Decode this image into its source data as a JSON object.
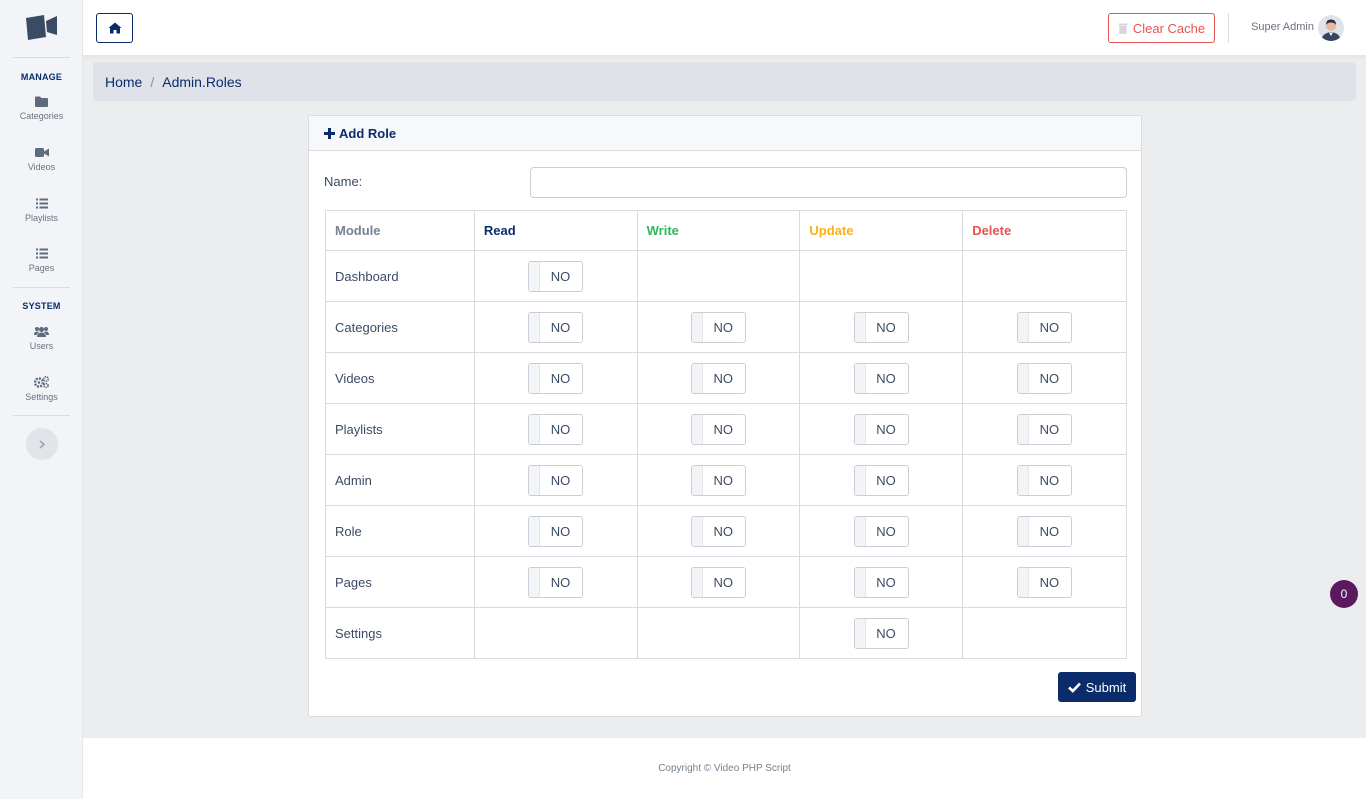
{
  "sidebar": {
    "sections": [
      {
        "title": "MANAGE",
        "items": [
          {
            "label": "Categories",
            "icon": "folder-icon"
          },
          {
            "label": "Videos",
            "icon": "video-icon"
          },
          {
            "label": "Playlists",
            "icon": "list-icon"
          },
          {
            "label": "Pages",
            "icon": "list-icon"
          }
        ]
      },
      {
        "title": "SYSTEM",
        "items": [
          {
            "label": "Users",
            "icon": "users-icon"
          },
          {
            "label": "Settings",
            "icon": "cogs-icon"
          }
        ]
      }
    ],
    "toggle_icon": "chevron-right-icon"
  },
  "header": {
    "clear_cache_label": "Clear Cache",
    "user_name": "Super Admin"
  },
  "breadcrumb": {
    "items": [
      "Home",
      "Admin.Roles"
    ]
  },
  "form": {
    "title": "Add Role",
    "name_label": "Name:",
    "name_value": "",
    "submit_label": "Submit",
    "columns": {
      "module": "Module",
      "read": "Read",
      "write": "Write",
      "update": "Update",
      "delete": "Delete"
    },
    "rows": [
      {
        "module": "Dashboard",
        "read": "NO",
        "write": "",
        "update": "",
        "delete": ""
      },
      {
        "module": "Categories",
        "read": "NO",
        "write": "NO",
        "update": "NO",
        "delete": "NO"
      },
      {
        "module": "Videos",
        "read": "NO",
        "write": "NO",
        "update": "NO",
        "delete": "NO"
      },
      {
        "module": "Playlists",
        "read": "NO",
        "write": "NO",
        "update": "NO",
        "delete": "NO"
      },
      {
        "module": "Admin",
        "read": "NO",
        "write": "NO",
        "update": "NO",
        "delete": "NO"
      },
      {
        "module": "Role",
        "read": "NO",
        "write": "NO",
        "update": "NO",
        "delete": "NO"
      },
      {
        "module": "Pages",
        "read": "NO",
        "write": "NO",
        "update": "NO",
        "delete": "NO"
      },
      {
        "module": "Settings",
        "read": "",
        "write": "",
        "update": "NO",
        "delete": ""
      }
    ]
  },
  "footer": {
    "copyright": "Copyright © Video PHP Script"
  },
  "floating_badge": "0",
  "colors": {
    "primary": "#0b2c6b",
    "write": "#2eb85c",
    "update": "#f9b115",
    "delete": "#e55353"
  }
}
